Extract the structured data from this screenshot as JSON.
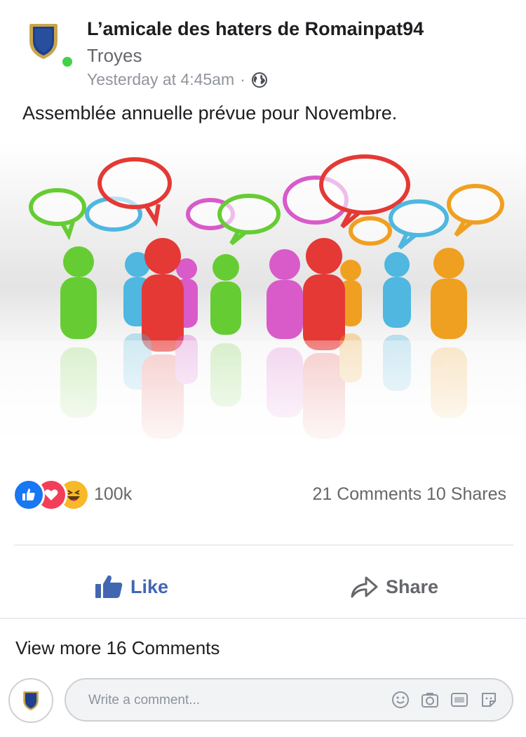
{
  "post": {
    "group_name": "L’amicale des haters de Romainpat94",
    "location": "Troyes",
    "timestamp": "Yesterday at 4:45am",
    "separator": "·",
    "privacy_icon": "globe-icon",
    "text": "Assemblée annuelle prévue pour Novembre."
  },
  "reactions": {
    "icons": [
      "like-reaction-icon",
      "love-reaction-icon",
      "haha-reaction-icon"
    ],
    "count": "100k",
    "comments_shares": "21 Comments 10 Shares"
  },
  "actions": {
    "like_label": "Like",
    "share_label": "Share"
  },
  "comments": {
    "view_more": "View more 16 Comments"
  },
  "composer": {
    "placeholder": "Write a comment...",
    "icons": [
      "emoji-icon",
      "camera-icon",
      "gif-icon",
      "sticker-icon"
    ]
  },
  "colors": {
    "accent_blue": "#4267b2",
    "like_blue": "#1877f2",
    "love_red": "#f33e58",
    "haha_yellow": "#f7b928",
    "online_green": "#42d149",
    "secondary_text": "#65676b"
  }
}
